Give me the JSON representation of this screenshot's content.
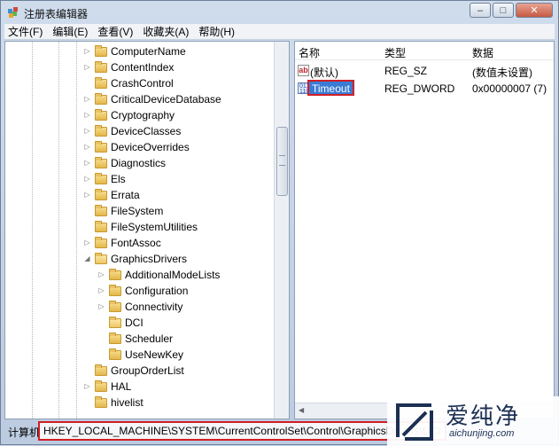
{
  "window": {
    "title": "注册表编辑器",
    "caption_buttons": [
      "–",
      "□",
      "✕"
    ]
  },
  "menu": [
    "文件(F)",
    "编辑(E)",
    "查看(V)",
    "收藏夹(A)",
    "帮助(H)"
  ],
  "tree": [
    {
      "label": "ComputerName",
      "expander": "▷"
    },
    {
      "label": "ContentIndex",
      "expander": "▷"
    },
    {
      "label": "CrashControl",
      "expander": ""
    },
    {
      "label": "CriticalDeviceDatabase",
      "expander": "▷"
    },
    {
      "label": "Cryptography",
      "expander": "▷"
    },
    {
      "label": "DeviceClasses",
      "expander": "▷"
    },
    {
      "label": "DeviceOverrides",
      "expander": "▷"
    },
    {
      "label": "Diagnostics",
      "expander": "▷"
    },
    {
      "label": "Els",
      "expander": "▷"
    },
    {
      "label": "Errata",
      "expander": "▷"
    },
    {
      "label": "FileSystem",
      "expander": ""
    },
    {
      "label": "FileSystemUtilities",
      "expander": ""
    },
    {
      "label": "FontAssoc",
      "expander": "▷"
    },
    {
      "label": "GraphicsDrivers",
      "expander": "◢"
    },
    {
      "label": "AdditionalModeLists",
      "expander": "▷"
    },
    {
      "label": "Configuration",
      "expander": "▷"
    },
    {
      "label": "Connectivity",
      "expander": "▷"
    },
    {
      "label": "DCI",
      "expander": ""
    },
    {
      "label": "Scheduler",
      "expander": ""
    },
    {
      "label": "UseNewKey",
      "expander": ""
    },
    {
      "label": "GroupOrderList",
      "expander": ""
    },
    {
      "label": "HAL",
      "expander": "▷"
    },
    {
      "label": "hivelist",
      "expander": ""
    }
  ],
  "list": {
    "headers": {
      "name": "名称",
      "type": "类型",
      "data": "数据"
    },
    "rows": [
      {
        "icon": "string-value-icon",
        "name": "(默认)",
        "type": "REG_SZ",
        "data": "(数值未设置)"
      },
      {
        "icon": "dword-value-icon",
        "name": "Timeout",
        "type": "REG_DWORD",
        "data": "0x00000007 (7)"
      }
    ]
  },
  "status": {
    "label": "计算机",
    "path": "HKEY_LOCAL_MACHINE\\SYSTEM\\CurrentControlSet\\Control\\GraphicsDrivers\\DCI"
  },
  "watermark": {
    "brand": "爱纯净",
    "url": "aichunjing.com"
  },
  "colors": {
    "highlight": "#d21f25",
    "selection": "#3a7bd5"
  }
}
